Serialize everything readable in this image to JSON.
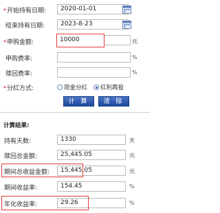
{
  "form": {
    "start_date": {
      "label": "开始持有日期:",
      "value": "2020-01-01"
    },
    "end_date": {
      "label": "结束持有日期:",
      "value": "2023-8-23"
    },
    "amount": {
      "label": "申购金额:",
      "value": "10000",
      "unit": "元"
    },
    "buy_fee": {
      "label": "申购费率:",
      "value": "",
      "unit": "%"
    },
    "redeem_fee": {
      "label": "赎回费率:",
      "value": "",
      "unit": "%"
    },
    "dividend": {
      "label": "分红方式:",
      "options": [
        {
          "label": "现金分红",
          "selected": false
        },
        {
          "label": "红利再投",
          "selected": true
        }
      ]
    },
    "calc_label": "计 算",
    "clear_label": "清 除"
  },
  "results": {
    "title": "计算结果:",
    "days": {
      "label": "持有天数:",
      "value": "1330",
      "unit": "天"
    },
    "redeem_total": {
      "label": "赎回总金额:",
      "value": "25,445.05",
      "unit": "元"
    },
    "total_gain": {
      "label": "期间总收益金额:",
      "value": "15,445.05",
      "unit": "元"
    },
    "period_rate": {
      "label": "期间收益率:",
      "value": "154.45",
      "unit": "%"
    },
    "annual_rate": {
      "label": "年化收益率:",
      "value": "29.26",
      "unit": "%"
    }
  },
  "colors": {
    "accent": "#2b5aa8",
    "highlight": "#e53935",
    "required": "#d0021b"
  }
}
